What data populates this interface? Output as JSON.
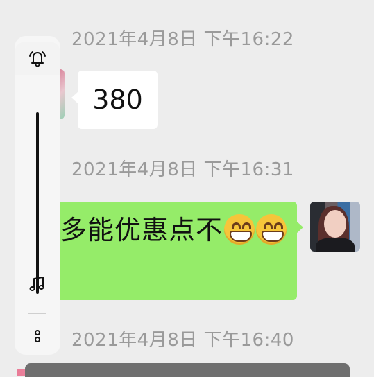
{
  "chat": {
    "timestamps": [
      "2021年4月8日 下午16:22",
      "2021年4月8日 下午16:31",
      "2021年4月8日 下午16:40"
    ],
    "messages": [
      {
        "side": "left",
        "text": "380"
      },
      {
        "side": "right",
        "text": "多能优惠点不",
        "emoji": "grinning-face-emoji"
      }
    ],
    "bubble_colors": {
      "incoming": "#ffffff",
      "outgoing": "#95ec69"
    }
  },
  "volume_panel": {
    "icons": [
      "bell-icon",
      "music-note-icon",
      "more-icon"
    ]
  },
  "background": "#ededed"
}
